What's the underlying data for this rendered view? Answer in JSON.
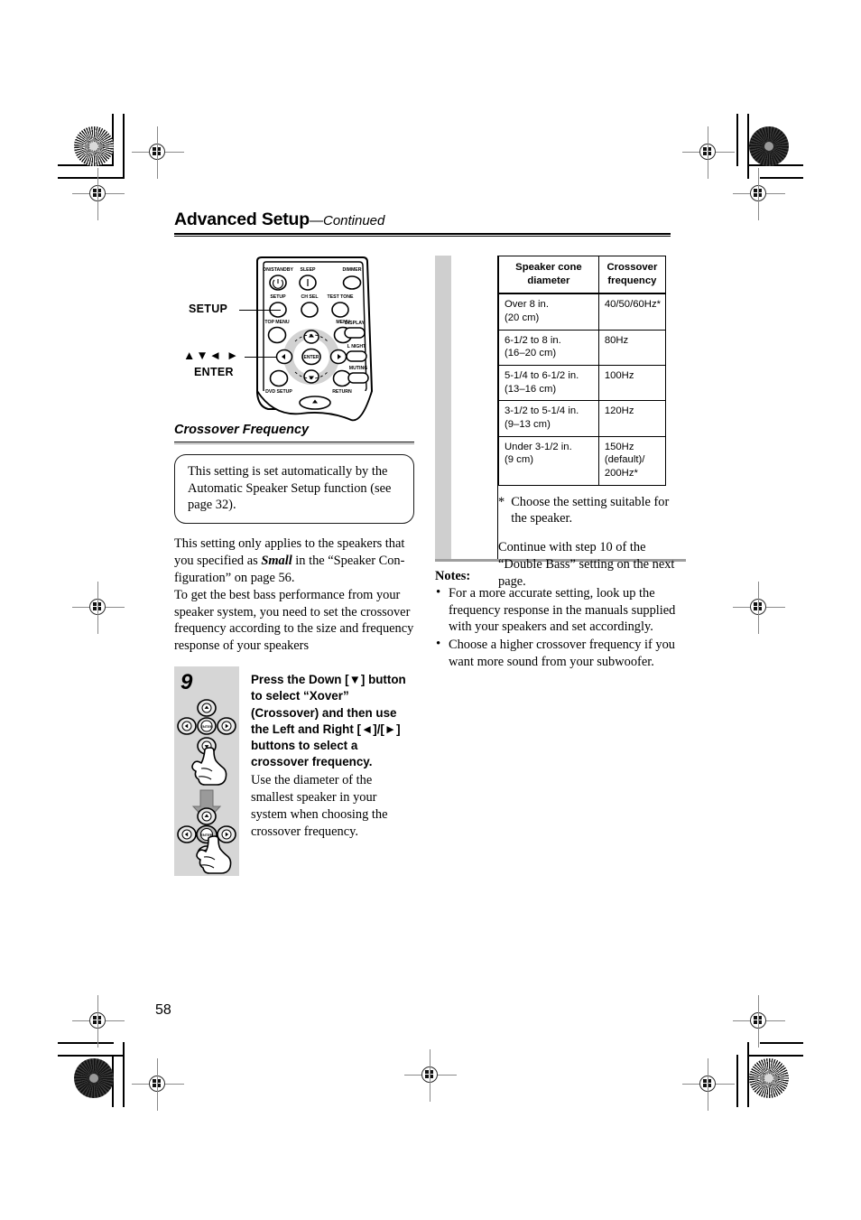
{
  "header": {
    "title": "Advanced Setup",
    "continued": "—Continued"
  },
  "remote_callouts": {
    "setup": "SETUP",
    "arrows": "▲▼◄ ►",
    "enter": "ENTER"
  },
  "remote_buttons": {
    "on_standby": "ON/STANDBY",
    "sleep": "SLEEP",
    "dimmer": "DIMMER",
    "setup": "SETUP",
    "ch_sel": "CH SEL",
    "test_tone": "TEST TONE",
    "top_menu": "TOP MENU",
    "menu": "MENU",
    "display": "DISPLAY",
    "l_night": "L NIGHT",
    "muting": "MUTING",
    "dvd_setup": "DVD SETUP",
    "return": "RETURN",
    "enter": "ENTER"
  },
  "section": {
    "heading": "Crossover Frequency",
    "tip": "This setting is set automatically by the Automatic Speaker Setup function (see page 32).",
    "para1_a": "This setting only applies to the speakers that you specified as ",
    "para1_em": "Small",
    "para1_b": " in the “Speaker Con­figuration” on page 56.",
    "para2": "To get the best bass performance from your speaker system, you need to set the crossover frequency according to the size and frequency response of your speakers"
  },
  "step": {
    "number": "9",
    "bold": "Press the Down [▼] button to select “Xover” (Crossover) and then use the Left and Right [◄]/[►] buttons to select a crossover frequency.",
    "body": "Use the diameter of the smallest speaker in your system when choosing the crossover fre­quency."
  },
  "table": {
    "headers": [
      "Speaker cone diameter",
      "Crossover frequency"
    ],
    "header_lines": [
      [
        "Speaker cone",
        "diameter"
      ],
      [
        "Crossover",
        "frequency"
      ]
    ],
    "rows": [
      {
        "diameter": [
          "Over 8 in.",
          "(20 cm)"
        ],
        "frequency": [
          "40/50/60Hz*"
        ]
      },
      {
        "diameter": [
          "6-1/2 to 8 in.",
          "(16–20 cm)"
        ],
        "frequency": [
          "80Hz"
        ]
      },
      {
        "diameter": [
          "5-1/4 to 6-1/2 in.",
          "(13–16 cm)"
        ],
        "frequency": [
          "100Hz"
        ]
      },
      {
        "diameter": [
          "3-1/2 to 5-1/4 in.",
          "(9–13 cm)"
        ],
        "frequency": [
          "120Hz"
        ]
      },
      {
        "diameter": [
          "Under 3-1/2 in.",
          "(9 cm)"
        ],
        "frequency": [
          "150Hz (default)/",
          "200Hz*"
        ]
      }
    ]
  },
  "footnote": {
    "marker": "*",
    "text": "Choose the setting suitable for the speaker."
  },
  "continue_note": "Continue with step 10 of the “Double Bass” setting on the next page.",
  "notes": {
    "title": "Notes:",
    "items": [
      "For a more accurate setting, look up the frequency response in the manuals supplied with your speakers and set accordingly.",
      "Choose a higher crossover frequency if you want more sound from your subwoofer."
    ]
  },
  "page_number": "58"
}
